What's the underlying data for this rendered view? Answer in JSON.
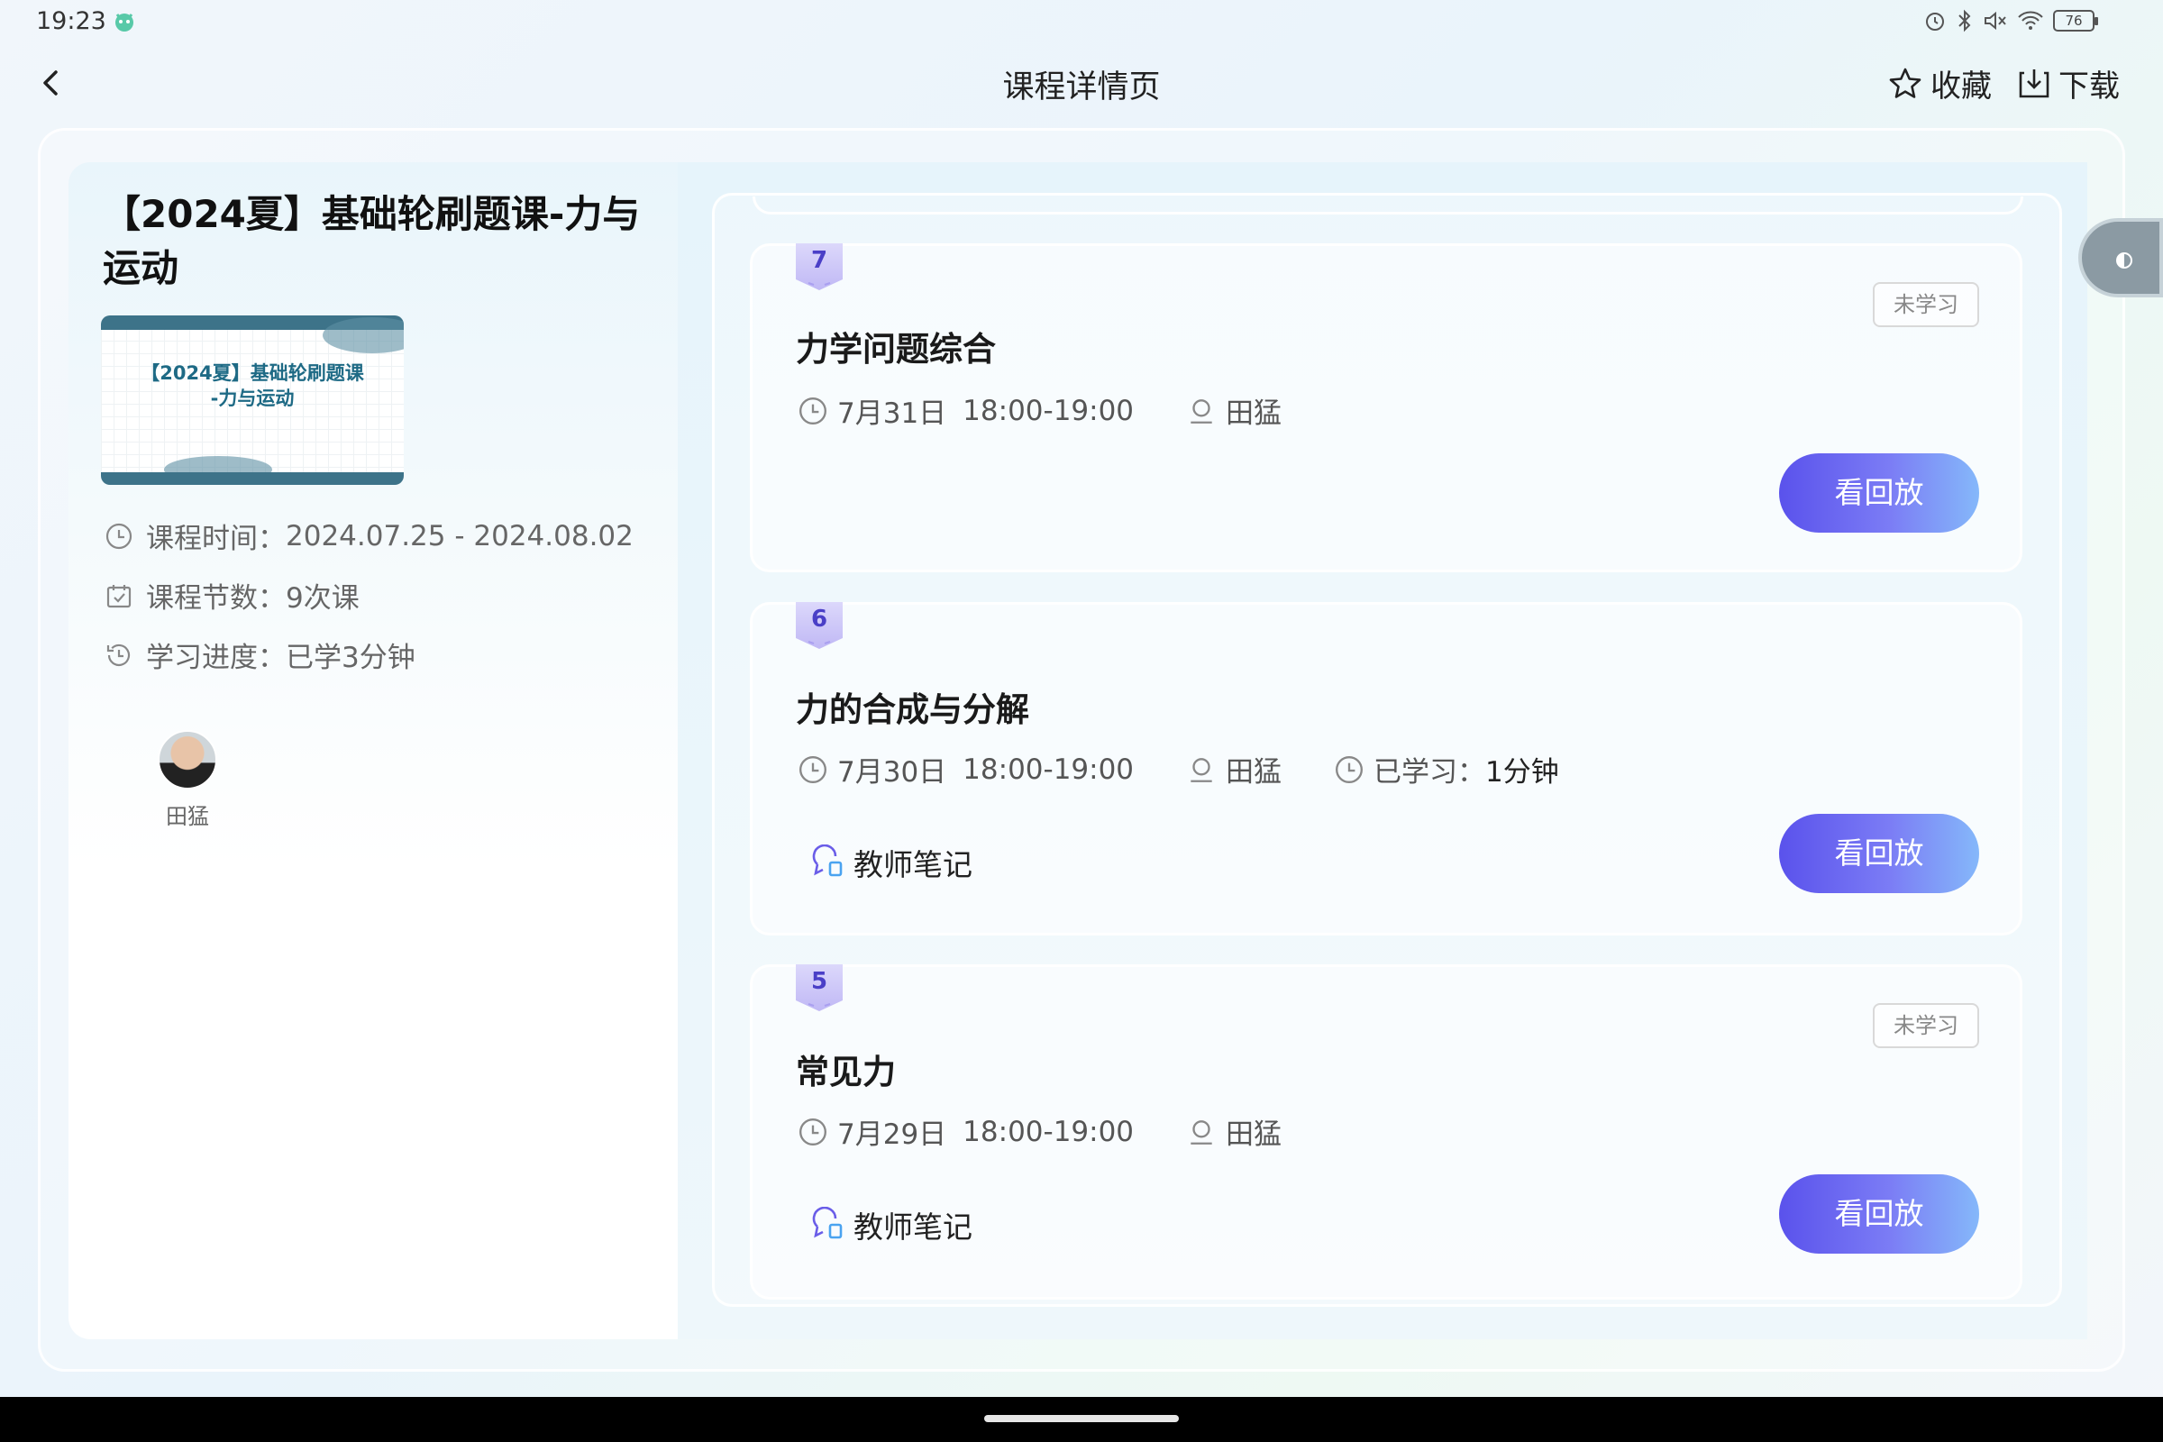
{
  "status_bar": {
    "time": "19:23",
    "battery": "76",
    "icons": [
      "alarm-icon",
      "bluetooth-icon",
      "mute-icon",
      "wifi-icon",
      "battery-icon"
    ]
  },
  "header": {
    "title": "课程详情页",
    "favorite_label": "收藏",
    "download_label": "下载"
  },
  "course": {
    "title": "【2024夏】基础轮刷题课-力与运动",
    "thumbnail_text_line1": "【2024夏】基础轮刷题课",
    "thumbnail_text_line2": "-力与运动",
    "time_label": "课程时间：",
    "time_value": "2024.07.25 - 2024.08.02",
    "count_label": "课程节数：",
    "count_value": "9次课",
    "progress_label": "学习进度：",
    "progress_value": "已学3分钟",
    "teacher": "田猛"
  },
  "lessons": [
    {
      "number": "7",
      "title": "力学问题综合",
      "date": "7月31日",
      "time": "18:00-19:00",
      "teacher": "田猛",
      "status": "未学习",
      "button": "看回放"
    },
    {
      "number": "6",
      "title": "力的合成与分解",
      "date": "7月30日",
      "time": "18:00-19:00",
      "teacher": "田猛",
      "studied_label": "已学习：",
      "studied_value": "1分钟",
      "notes": "教师笔记",
      "button": "看回放"
    },
    {
      "number": "5",
      "title": "常见力",
      "date": "7月29日",
      "time": "18:00-19:00",
      "teacher": "田猛",
      "status": "未学习",
      "notes": "教师笔记",
      "button": "看回放"
    }
  ],
  "colors": {
    "accent_start": "#5a52ec",
    "accent_end": "#85b8fa",
    "badge": "#4a3fc7"
  }
}
